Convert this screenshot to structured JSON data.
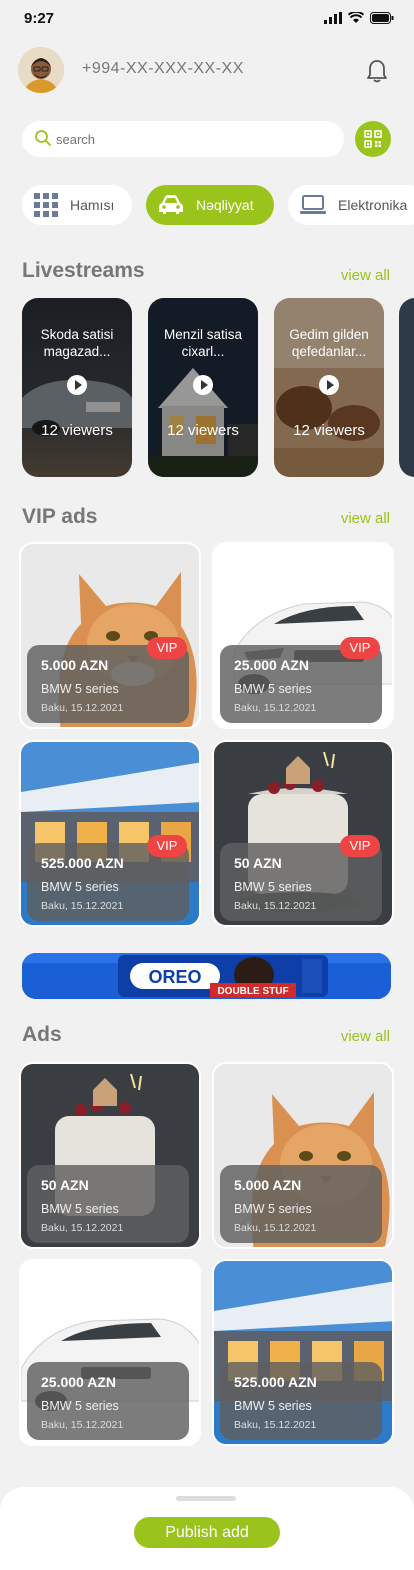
{
  "status": {
    "time": "9:27"
  },
  "header": {
    "phone": "+994-XX-XXX-XX-XX"
  },
  "search": {
    "placeholder": "search"
  },
  "categories": [
    {
      "label": "Hamısı",
      "icon": "grid-icon"
    },
    {
      "label": "Nəqliyyat",
      "icon": "car-icon",
      "active": true
    },
    {
      "label": "Elektronika",
      "icon": "laptop-icon"
    }
  ],
  "livestreams": {
    "title": "Livestreams",
    "view_all": "view all",
    "items": [
      {
        "title": "Skoda satisi magazad...",
        "viewers": "12 viewers"
      },
      {
        "title": "Menzil satisa cixarl...",
        "viewers": "12 viewers"
      },
      {
        "title": "Gedim gilden qefedanlar...",
        "viewers": "12 viewers"
      }
    ]
  },
  "vip": {
    "title": "VIP ads",
    "view_all": "view all",
    "badge": "VIP",
    "items": [
      {
        "price": "5.000 AZN",
        "name": "BMW 5 series",
        "meta": "Baku, 15.12.2021"
      },
      {
        "price": "25.000 AZN",
        "name": "BMW 5 series",
        "meta": "Baku, 15.12.2021"
      },
      {
        "price": "525.000 AZN",
        "name": "BMW 5 series",
        "meta": "Baku, 15.12.2021"
      },
      {
        "price": "50 AZN",
        "name": "BMW 5 series",
        "meta": "Baku, 15.12.2021"
      }
    ]
  },
  "banner": {
    "brand": "OREO",
    "tagline": "DOUBLE STUF"
  },
  "ads": {
    "title": "Ads",
    "view_all": "view all",
    "items": [
      {
        "price": "50 AZN",
        "name": "BMW 5 series",
        "meta": "Baku, 15.12.2021"
      },
      {
        "price": "5.000 AZN",
        "name": "BMW 5 series",
        "meta": "Baku, 15.12.2021"
      },
      {
        "price": "25.000 AZN",
        "name": "BMW 5 series",
        "meta": "Baku, 15.12.2021"
      },
      {
        "price": "525.000 AZN",
        "name": "BMW 5 series",
        "meta": "Baku, 15.12.2021"
      }
    ]
  },
  "bottom": {
    "publish_label": "Publish add"
  },
  "colors": {
    "accent": "#9ac31c",
    "vip": "#ef4444"
  }
}
